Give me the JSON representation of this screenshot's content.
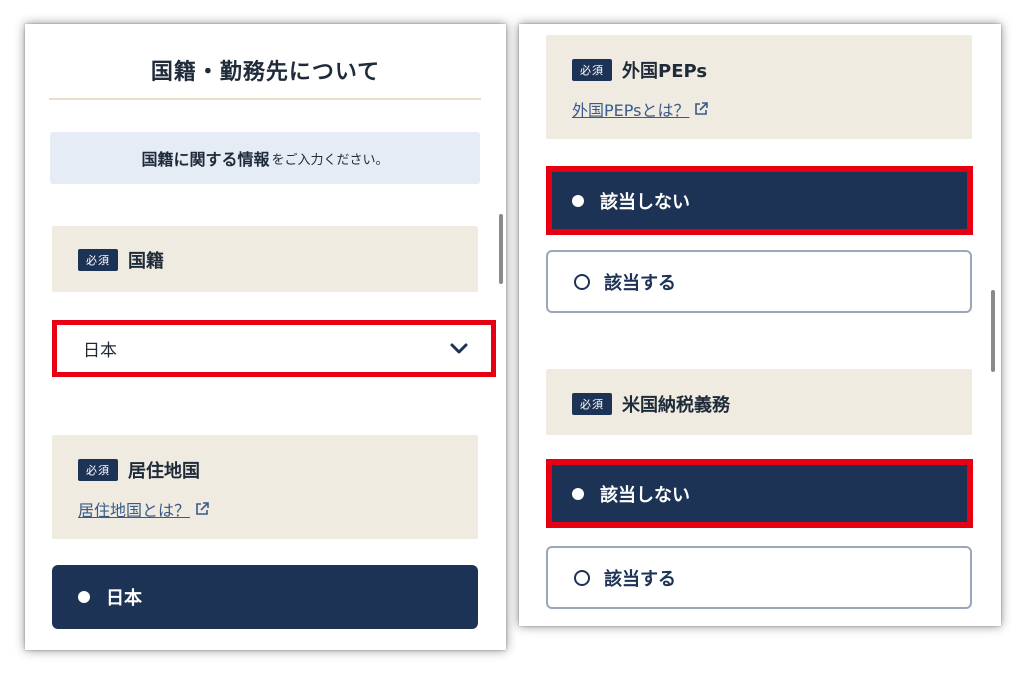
{
  "left": {
    "title": "国籍・勤務先について",
    "banner": {
      "bold": "国籍に関する情報",
      "rest": "をご入力ください。"
    },
    "nationality": {
      "badge": "必須",
      "label": "国籍",
      "value": "日本"
    },
    "residence": {
      "badge": "必須",
      "label": "居住地国",
      "link": "居住地国とは？",
      "option": "日本"
    }
  },
  "right": {
    "peps": {
      "badge": "必須",
      "label": "外国PEPs",
      "link": "外国PEPsとは？",
      "option_selected": "該当しない",
      "option_other": "該当する"
    },
    "tax": {
      "badge": "必須",
      "label": "米国納税義務",
      "option_selected": "該当しない",
      "option_other": "該当する"
    }
  },
  "colors": {
    "navy": "#1d3355",
    "highlight": "#e60012",
    "beige": "#efebe0",
    "banner": "#e6ecf5"
  }
}
